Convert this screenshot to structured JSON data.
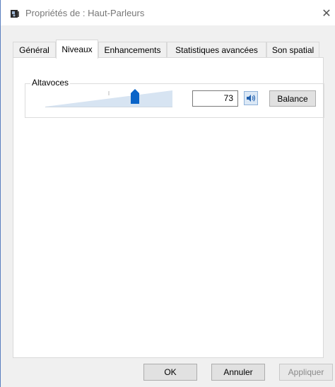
{
  "window": {
    "title": "Propriétés de : Haut-Parleurs",
    "close_symbol": "✕"
  },
  "tabs": [
    {
      "label": "Général",
      "active": false
    },
    {
      "label": "Niveaux",
      "active": true
    },
    {
      "label": "Enhancements",
      "active": false
    },
    {
      "label": "Statistiques avancées",
      "active": false
    },
    {
      "label": "Son spatial",
      "active": false
    }
  ],
  "levels": {
    "group_label": "Altavoces",
    "volume_value": "73",
    "volume_level": 73,
    "speaker_icon": "speaker-icon",
    "balance_label": "Balance"
  },
  "footer": {
    "ok_label": "OK",
    "cancel_label": "Annuler",
    "apply_label": "Appliquer"
  },
  "colors": {
    "accent": "#0a64c8",
    "slider_track": "#d7e4f2"
  }
}
